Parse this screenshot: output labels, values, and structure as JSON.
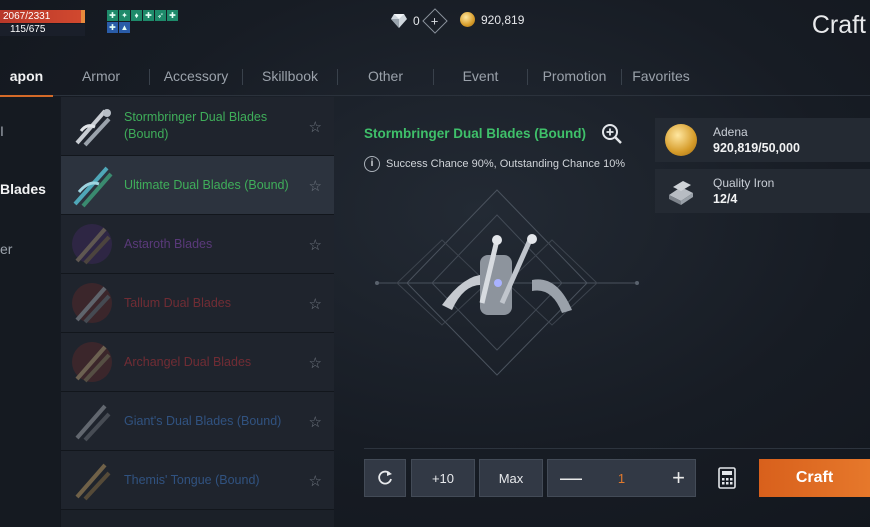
{
  "hud": {
    "hp": "2067/2331",
    "mp": "115/675",
    "diamonds": "0",
    "adena": "920,819"
  },
  "page_title": "Craft",
  "tabs": [
    {
      "label": "apon",
      "active": true
    },
    {
      "label": "Armor"
    },
    {
      "label": "Accessory"
    },
    {
      "label": "Skillbook"
    },
    {
      "label": "Other"
    },
    {
      "label": "Event"
    },
    {
      "label": "Promotion"
    },
    {
      "label": "Favorites"
    }
  ],
  "categories": [
    {
      "label": "I"
    },
    {
      "label": "Blades",
      "active": true
    },
    {
      "label": "er"
    }
  ],
  "items": [
    {
      "name": "Stormbringer Dual Blades (Bound)",
      "color": "#3fae5a"
    },
    {
      "name": "Ultimate Dual Blades (Bound)",
      "color": "#3fae5a",
      "selected": true
    },
    {
      "name": "Astaroth Blades",
      "color": "#8a4bb8"
    },
    {
      "name": "Tallum Dual Blades",
      "color": "#b3333a"
    },
    {
      "name": "Archangel Dual Blades",
      "color": "#b3333a"
    },
    {
      "name": "Giant's Dual Blades (Bound)",
      "color": "#3f78c4"
    },
    {
      "name": "Themis' Tongue (Bound)",
      "color": "#3f78c4"
    }
  ],
  "detail": {
    "title": "Stormbringer Dual Blades (Bound)",
    "title_color": "#3fc06a",
    "chance": "Success Chance 90%, Outstanding Chance 10%"
  },
  "materials": [
    {
      "name": "Adena",
      "value": "920,819/50,000",
      "icon": "coin-icon"
    },
    {
      "name": "Quality Iron",
      "value": "12/4",
      "icon": "iron-icon"
    }
  ],
  "controls": {
    "plus10": "+10",
    "max": "Max",
    "quantity": "1",
    "craft": "Craft"
  }
}
